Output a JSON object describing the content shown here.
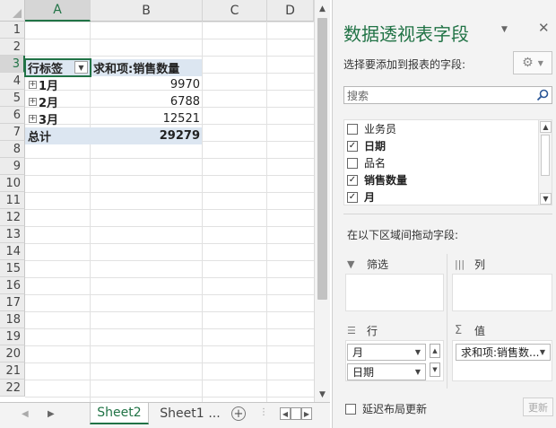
{
  "spreadsheet": {
    "columns": [
      "A",
      "B",
      "C",
      "D"
    ],
    "rows": [
      "1",
      "2",
      "3",
      "4",
      "5",
      "6",
      "7",
      "8",
      "9",
      "10",
      "11",
      "12",
      "13",
      "14",
      "15",
      "16",
      "17",
      "18",
      "19",
      "20",
      "21",
      "22"
    ],
    "pivot": {
      "row_label_header": "行标签",
      "value_header": "求和项:销售数量",
      "rows": [
        {
          "label": "1月",
          "value": "9970"
        },
        {
          "label": "2月",
          "value": "6788"
        },
        {
          "label": "3月",
          "value": "12521"
        }
      ],
      "total_label": "总计",
      "total_value": "29279"
    },
    "sheet_tabs": [
      "Sheet2",
      "Sheet1"
    ],
    "more_tabs": "..."
  },
  "pane": {
    "title": "数据透视表字段",
    "choose_label": "选择要添加到报表的字段:",
    "search_placeholder": "搜索",
    "fields": [
      {
        "label": "业务员",
        "checked": false,
        "bold": false
      },
      {
        "label": "日期",
        "checked": true,
        "bold": true
      },
      {
        "label": "品名",
        "checked": false,
        "bold": false
      },
      {
        "label": "销售数量",
        "checked": true,
        "bold": true
      },
      {
        "label": "月",
        "checked": true,
        "bold": true
      }
    ],
    "drag_label": "在以下区域间拖动字段:",
    "areas": {
      "filters": "筛选",
      "columns": "列",
      "rows": "行",
      "values": "值"
    },
    "row_items": [
      "月",
      "日期"
    ],
    "value_items": [
      "求和项:销售数..."
    ],
    "defer_label": "延迟布局更新",
    "update_button": "更新"
  },
  "colors": {
    "accent": "#217346",
    "pivot_band": "#dce6f1"
  }
}
